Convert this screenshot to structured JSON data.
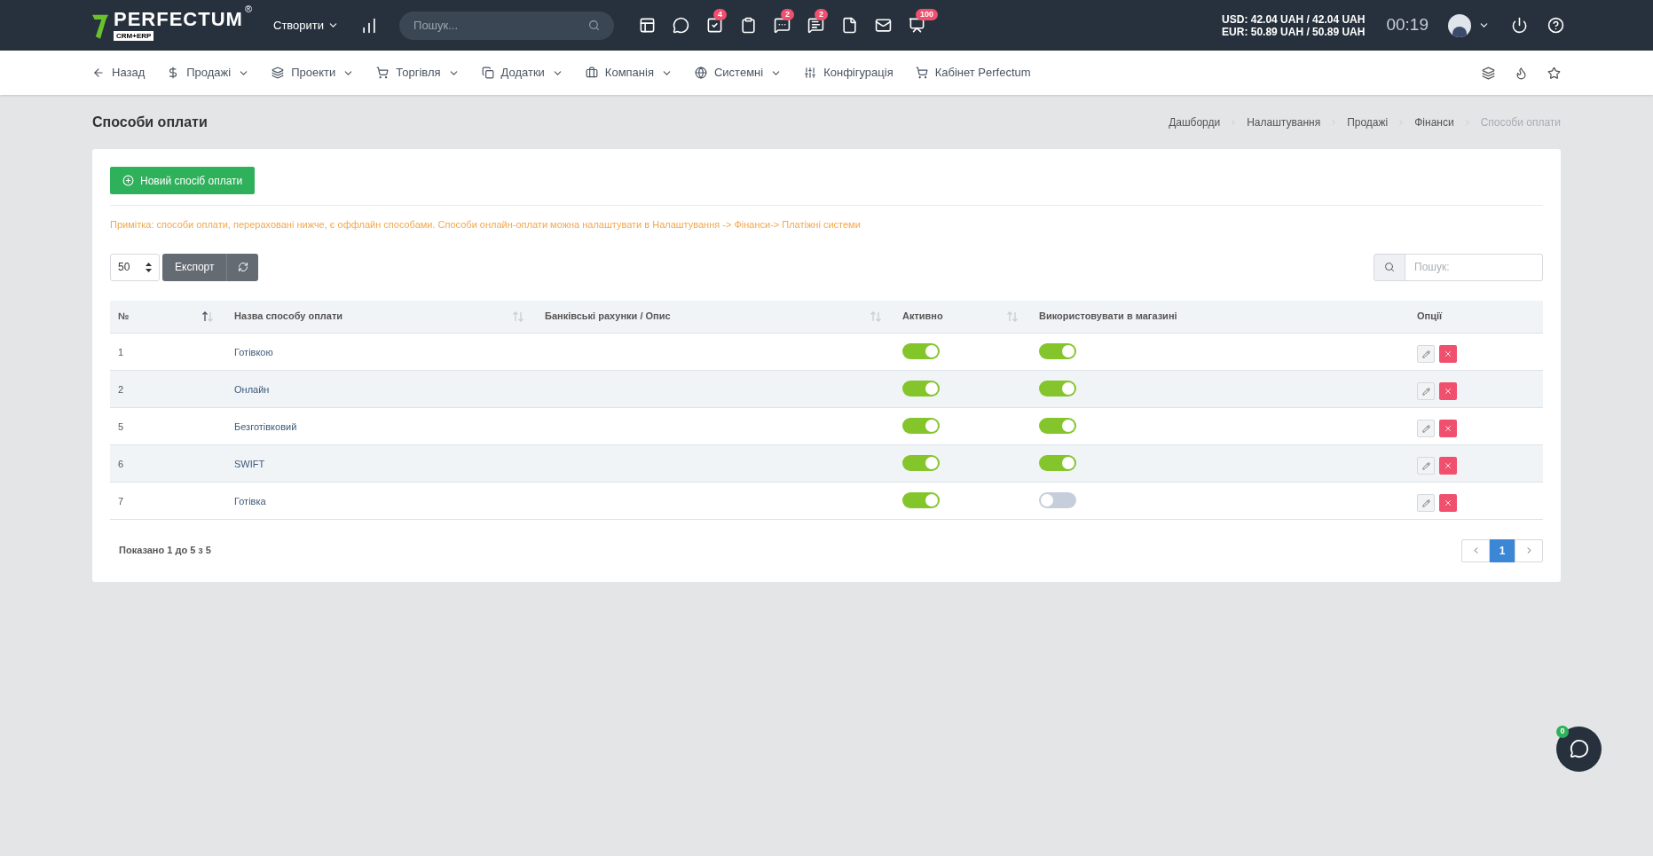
{
  "header": {
    "logo": {
      "name": "PERFECTUM",
      "mark": "®",
      "sub": "CRM+ERP"
    },
    "create_menu": "Створити",
    "search": {
      "placeholder": "Пошук..."
    },
    "toolbar": [
      {
        "kind": "plain"
      },
      {
        "kind": "plain"
      },
      {
        "kind": "badged",
        "badge": "4"
      },
      {
        "kind": "plain"
      },
      {
        "kind": "badged",
        "badge": "2"
      },
      {
        "kind": "badged",
        "badge": "2"
      },
      {
        "kind": "plain"
      },
      {
        "kind": "plain"
      },
      {
        "kind": "badged",
        "badge": "100"
      }
    ],
    "currency": [
      "USD: 42.04 UAH / 42.04 UAH",
      "EUR: 50.89 UAH / 50.89 UAH"
    ],
    "timer": "00:19"
  },
  "nav": {
    "items": [
      {
        "label": "Назад",
        "has_menu": false
      },
      {
        "label": "Продажі",
        "has_menu": true
      },
      {
        "label": "Проекти",
        "has_menu": true
      },
      {
        "label": "Торгівля",
        "has_menu": true
      },
      {
        "label": "Додатки",
        "has_menu": true
      },
      {
        "label": "Компанія",
        "has_menu": true
      },
      {
        "label": "Системні",
        "has_menu": true
      },
      {
        "label": "Конфігурація",
        "has_menu": false
      },
      {
        "label": "Кабінет Perfectum",
        "has_menu": false
      }
    ]
  },
  "page": {
    "title": "Способи оплати",
    "breadcrumbs": [
      {
        "label": "Дашборди",
        "current": false
      },
      {
        "label": "Налаштування",
        "current": false
      },
      {
        "label": "Продажі",
        "current": false
      },
      {
        "label": "Фінанси",
        "current": false
      },
      {
        "label": "Способи оплати",
        "current": true
      }
    ]
  },
  "new_button": "Новий спосіб оплати",
  "note": "Примітка: способи оплати, перераховані нижче, є оффлайн способами. Способи онлайн-оплати можна налаштувати в Налаштування -> Фінанси-> Платіжні системи",
  "page_size": "50",
  "export_button": "Експорт",
  "table_search": {
    "placeholder": "Пошук:"
  },
  "table": {
    "columns": [
      {
        "label": "№",
        "sortable": true,
        "sorted": true
      },
      {
        "label": "Назва способу оплати",
        "sortable": true,
        "sorted": false
      },
      {
        "label": "Банківські рахунки / Опис",
        "sortable": true,
        "sorted": false
      },
      {
        "label": "Активно",
        "sortable": true,
        "sorted": false
      },
      {
        "label": "Використовувати в магазині",
        "sortable": false
      },
      {
        "label": "Опції",
        "sortable": false
      }
    ],
    "rows": [
      {
        "number": "1",
        "name": "Готівкою",
        "active": true,
        "in_store": true
      },
      {
        "number": "2",
        "name": "Онлайн",
        "active": true,
        "in_store": true
      },
      {
        "number": "5",
        "name": "Безготівковий",
        "active": true,
        "in_store": true
      },
      {
        "number": "6",
        "name": "SWIFT",
        "active": true,
        "in_store": true
      },
      {
        "number": "7",
        "name": "Готівка",
        "active": true,
        "in_store": false
      }
    ]
  },
  "footer": {
    "info": "Показано 1 до 5 з 5",
    "pages": [
      {
        "label": "1",
        "selected": true
      }
    ]
  },
  "chat": {
    "badge": "0"
  }
}
